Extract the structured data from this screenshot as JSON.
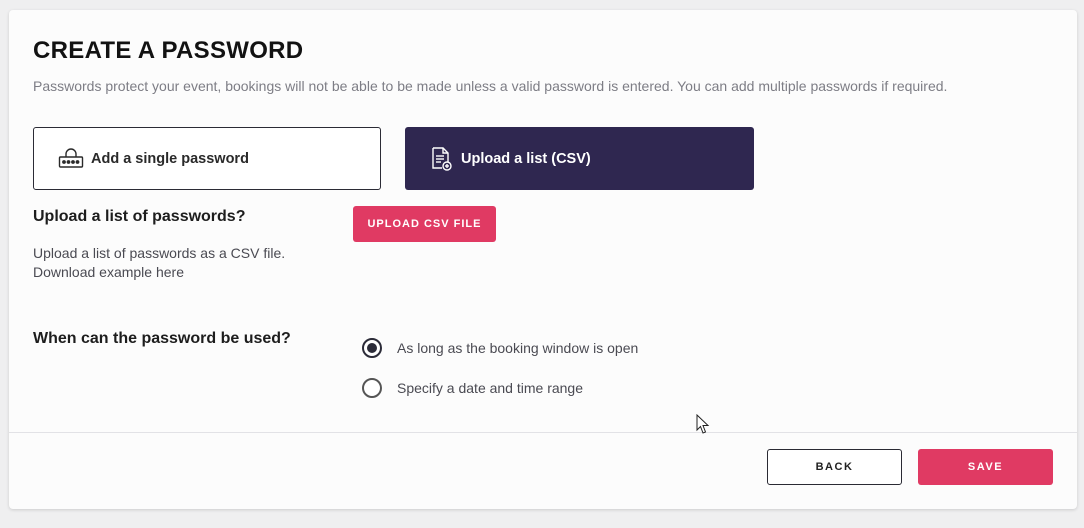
{
  "page": {
    "title": "CREATE A PASSWORD",
    "subtitle": "Passwords protect your event, bookings will not be able to be made unless a valid password is entered. You can add multiple passwords if required."
  },
  "options": {
    "single": {
      "label": "Add a single password",
      "icon": "password-lock-icon",
      "selected": false
    },
    "csv": {
      "label": "Upload a list (CSV)",
      "icon": "document-upload-icon",
      "selected": true
    }
  },
  "upload": {
    "heading": "Upload a list of passwords?",
    "description": "Upload a list of passwords as a CSV file.",
    "link": "Download example here",
    "button": "UPLOAD CSV FILE"
  },
  "usage": {
    "heading": "When can the password be used?",
    "options": [
      {
        "label": "As long as the booking window is open",
        "checked": true
      },
      {
        "label": "Specify a date and time range",
        "checked": false
      }
    ]
  },
  "footer": {
    "back": "BACK",
    "save": "SAVE"
  },
  "colors": {
    "accent": "#e03a63",
    "selected_option": "#2f2750",
    "background": "#efeff0"
  }
}
